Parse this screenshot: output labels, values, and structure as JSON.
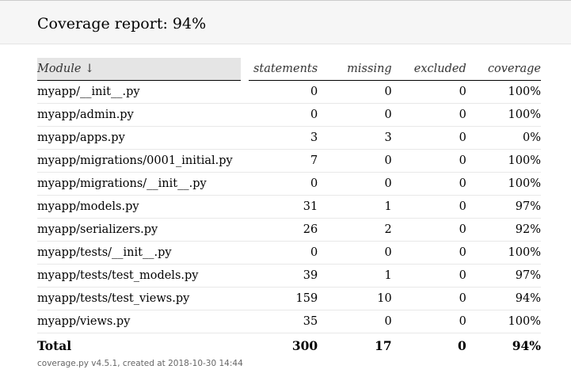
{
  "header": {
    "title": "Coverage report: 94%"
  },
  "table": {
    "columns": {
      "module": "Module ↓",
      "statements": "statements",
      "missing": "missing",
      "excluded": "excluded",
      "coverage": "coverage"
    },
    "rows": [
      {
        "module": "myapp/__init__.py",
        "statements": "0",
        "missing": "0",
        "excluded": "0",
        "coverage": "100%"
      },
      {
        "module": "myapp/admin.py",
        "statements": "0",
        "missing": "0",
        "excluded": "0",
        "coverage": "100%"
      },
      {
        "module": "myapp/apps.py",
        "statements": "3",
        "missing": "3",
        "excluded": "0",
        "coverage": "0%"
      },
      {
        "module": "myapp/migrations/0001_initial.py",
        "statements": "7",
        "missing": "0",
        "excluded": "0",
        "coverage": "100%"
      },
      {
        "module": "myapp/migrations/__init__.py",
        "statements": "0",
        "missing": "0",
        "excluded": "0",
        "coverage": "100%"
      },
      {
        "module": "myapp/models.py",
        "statements": "31",
        "missing": "1",
        "excluded": "0",
        "coverage": "97%"
      },
      {
        "module": "myapp/serializers.py",
        "statements": "26",
        "missing": "2",
        "excluded": "0",
        "coverage": "92%"
      },
      {
        "module": "myapp/tests/__init__.py",
        "statements": "0",
        "missing": "0",
        "excluded": "0",
        "coverage": "100%"
      },
      {
        "module": "myapp/tests/test_models.py",
        "statements": "39",
        "missing": "1",
        "excluded": "0",
        "coverage": "97%"
      },
      {
        "module": "myapp/tests/test_views.py",
        "statements": "159",
        "missing": "10",
        "excluded": "0",
        "coverage": "94%"
      },
      {
        "module": "myapp/views.py",
        "statements": "35",
        "missing": "0",
        "excluded": "0",
        "coverage": "100%"
      }
    ],
    "total": {
      "module": "Total",
      "statements": "300",
      "missing": "17",
      "excluded": "0",
      "coverage": "94%"
    }
  },
  "footer": {
    "text": "coverage.py v4.5.1, created at 2018-10-30 14:44"
  }
}
